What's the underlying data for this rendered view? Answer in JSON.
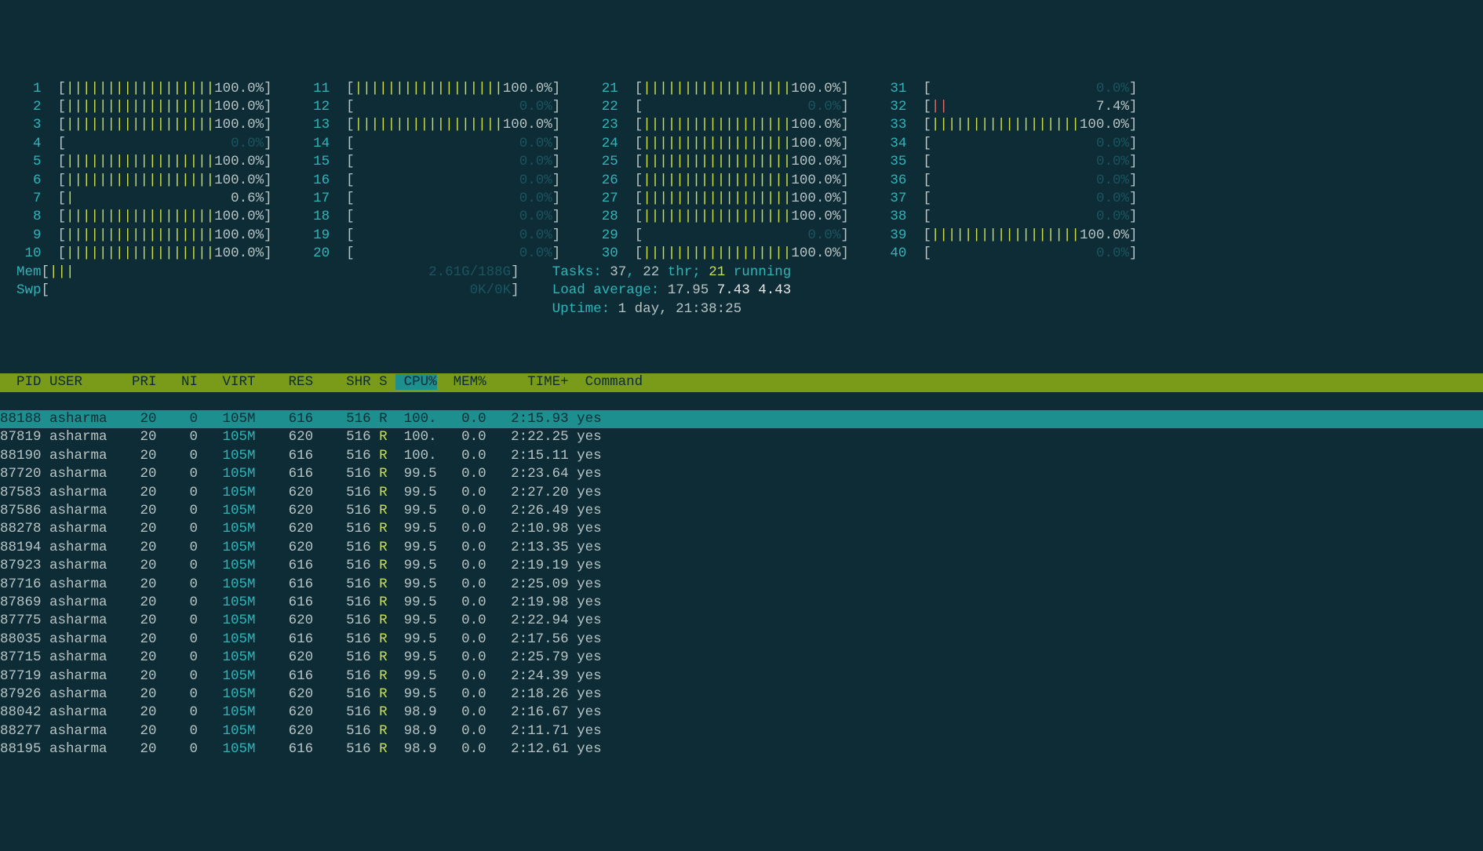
{
  "meters": {
    "layout_columns": 4,
    "cpus": [
      {
        "n": 1,
        "pct": 100.0,
        "bars": "||||||||||||||||||",
        "bar_color": "green"
      },
      {
        "n": 2,
        "pct": 100.0,
        "bars": "||||||||||||||||||",
        "bar_color": "green"
      },
      {
        "n": 3,
        "pct": 100.0,
        "bars": "||||||||||||||||||",
        "bar_color": "green"
      },
      {
        "n": 4,
        "pct": 0.0,
        "bars": "",
        "bar_color": "green"
      },
      {
        "n": 5,
        "pct": 100.0,
        "bars": "||||||||||||||||||",
        "bar_color": "green"
      },
      {
        "n": 6,
        "pct": 100.0,
        "bars": "||||||||||||||||||",
        "bar_color": "green"
      },
      {
        "n": 7,
        "pct": 0.6,
        "bars": "|",
        "bar_color": "green"
      },
      {
        "n": 8,
        "pct": 100.0,
        "bars": "||||||||||||||||||",
        "bar_color": "green"
      },
      {
        "n": 9,
        "pct": 100.0,
        "bars": "||||||||||||||||||",
        "bar_color": "green"
      },
      {
        "n": 10,
        "pct": 100.0,
        "bars": "||||||||||||||||||",
        "bar_color": "green"
      },
      {
        "n": 11,
        "pct": 100.0,
        "bars": "||||||||||||||||||",
        "bar_color": "green"
      },
      {
        "n": 12,
        "pct": 0.0,
        "bars": "",
        "bar_color": "green"
      },
      {
        "n": 13,
        "pct": 100.0,
        "bars": "||||||||||||||||||",
        "bar_color": "green"
      },
      {
        "n": 14,
        "pct": 0.0,
        "bars": "",
        "bar_color": "green"
      },
      {
        "n": 15,
        "pct": 0.0,
        "bars": "",
        "bar_color": "green"
      },
      {
        "n": 16,
        "pct": 0.0,
        "bars": "",
        "bar_color": "green"
      },
      {
        "n": 17,
        "pct": 0.0,
        "bars": "",
        "bar_color": "green"
      },
      {
        "n": 18,
        "pct": 0.0,
        "bars": "",
        "bar_color": "green"
      },
      {
        "n": 19,
        "pct": 0.0,
        "bars": "",
        "bar_color": "green"
      },
      {
        "n": 20,
        "pct": 0.0,
        "bars": "",
        "bar_color": "green"
      },
      {
        "n": 21,
        "pct": 100.0,
        "bars": "||||||||||||||||||",
        "bar_color": "green"
      },
      {
        "n": 22,
        "pct": 0.0,
        "bars": "",
        "bar_color": "green"
      },
      {
        "n": 23,
        "pct": 100.0,
        "bars": "||||||||||||||||||",
        "bar_color": "green"
      },
      {
        "n": 24,
        "pct": 100.0,
        "bars": "||||||||||||||||||",
        "bar_color": "green"
      },
      {
        "n": 25,
        "pct": 100.0,
        "bars": "||||||||||||||||||",
        "bar_color": "green"
      },
      {
        "n": 26,
        "pct": 100.0,
        "bars": "||||||||||||||||||",
        "bar_color": "green"
      },
      {
        "n": 27,
        "pct": 100.0,
        "bars": "||||||||||||||||||",
        "bar_color": "green"
      },
      {
        "n": 28,
        "pct": 100.0,
        "bars": "||||||||||||||||||",
        "bar_color": "green"
      },
      {
        "n": 29,
        "pct": 0.0,
        "bars": "",
        "bar_color": "green"
      },
      {
        "n": 30,
        "pct": 100.0,
        "bars": "||||||||||||||||||",
        "bar_color": "green"
      },
      {
        "n": 31,
        "pct": 0.0,
        "bars": "",
        "bar_color": "green"
      },
      {
        "n": 32,
        "pct": 7.4,
        "bars": "||",
        "bar_color": "red"
      },
      {
        "n": 33,
        "pct": 100.0,
        "bars": "||||||||||||||||||",
        "bar_color": "green"
      },
      {
        "n": 34,
        "pct": 0.0,
        "bars": "",
        "bar_color": "green"
      },
      {
        "n": 35,
        "pct": 0.0,
        "bars": "",
        "bar_color": "green"
      },
      {
        "n": 36,
        "pct": 0.0,
        "bars": "",
        "bar_color": "green"
      },
      {
        "n": 37,
        "pct": 0.0,
        "bars": "",
        "bar_color": "green"
      },
      {
        "n": 38,
        "pct": 0.0,
        "bars": "",
        "bar_color": "green"
      },
      {
        "n": 39,
        "pct": 100.0,
        "bars": "||||||||||||||||||",
        "bar_color": "green"
      },
      {
        "n": 40,
        "pct": 0.0,
        "bars": "",
        "bar_color": "green"
      }
    ],
    "mem": {
      "label": "Mem",
      "bars": "|||",
      "used": "2.61G",
      "total": "188G"
    },
    "swp": {
      "label": "Swp",
      "bars": "",
      "used": "0K",
      "total": "0K"
    }
  },
  "summary": {
    "tasks_label": "Tasks:",
    "tasks_total": "37",
    "tasks_sep": ", ",
    "thr_count": "22",
    "thr_label": " thr; ",
    "running_count": "21",
    "running_label": " running",
    "load_label": "Load average:",
    "load1": "17.95",
    "load5": "7.43",
    "load15": "4.43",
    "uptime_label": "Uptime:",
    "uptime_value": "1 day, 21:38:25"
  },
  "table": {
    "columns": [
      "PID",
      "USER",
      "PRI",
      "NI",
      "VIRT",
      "RES",
      "SHR",
      "S",
      "CPU%",
      "MEM%",
      "TIME+",
      "Command"
    ],
    "sort_column": "CPU%",
    "selected_index": 0,
    "rows": [
      {
        "pid": "88188",
        "user": "asharma",
        "pri": "20",
        "ni": "0",
        "virt": "105M",
        "res": "616",
        "shr": "516",
        "s": "R",
        "cpu": "100.",
        "mem": "0.0",
        "time": "2:15.93",
        "cmd": "yes"
      },
      {
        "pid": "87819",
        "user": "asharma",
        "pri": "20",
        "ni": "0",
        "virt": "105M",
        "res": "620",
        "shr": "516",
        "s": "R",
        "cpu": "100.",
        "mem": "0.0",
        "time": "2:22.25",
        "cmd": "yes"
      },
      {
        "pid": "88190",
        "user": "asharma",
        "pri": "20",
        "ni": "0",
        "virt": "105M",
        "res": "616",
        "shr": "516",
        "s": "R",
        "cpu": "100.",
        "mem": "0.0",
        "time": "2:15.11",
        "cmd": "yes"
      },
      {
        "pid": "87720",
        "user": "asharma",
        "pri": "20",
        "ni": "0",
        "virt": "105M",
        "res": "616",
        "shr": "516",
        "s": "R",
        "cpu": "99.5",
        "mem": "0.0",
        "time": "2:23.64",
        "cmd": "yes"
      },
      {
        "pid": "87583",
        "user": "asharma",
        "pri": "20",
        "ni": "0",
        "virt": "105M",
        "res": "620",
        "shr": "516",
        "s": "R",
        "cpu": "99.5",
        "mem": "0.0",
        "time": "2:27.20",
        "cmd": "yes"
      },
      {
        "pid": "87586",
        "user": "asharma",
        "pri": "20",
        "ni": "0",
        "virt": "105M",
        "res": "620",
        "shr": "516",
        "s": "R",
        "cpu": "99.5",
        "mem": "0.0",
        "time": "2:26.49",
        "cmd": "yes"
      },
      {
        "pid": "88278",
        "user": "asharma",
        "pri": "20",
        "ni": "0",
        "virt": "105M",
        "res": "620",
        "shr": "516",
        "s": "R",
        "cpu": "99.5",
        "mem": "0.0",
        "time": "2:10.98",
        "cmd": "yes"
      },
      {
        "pid": "88194",
        "user": "asharma",
        "pri": "20",
        "ni": "0",
        "virt": "105M",
        "res": "620",
        "shr": "516",
        "s": "R",
        "cpu": "99.5",
        "mem": "0.0",
        "time": "2:13.35",
        "cmd": "yes"
      },
      {
        "pid": "87923",
        "user": "asharma",
        "pri": "20",
        "ni": "0",
        "virt": "105M",
        "res": "616",
        "shr": "516",
        "s": "R",
        "cpu": "99.5",
        "mem": "0.0",
        "time": "2:19.19",
        "cmd": "yes"
      },
      {
        "pid": "87716",
        "user": "asharma",
        "pri": "20",
        "ni": "0",
        "virt": "105M",
        "res": "616",
        "shr": "516",
        "s": "R",
        "cpu": "99.5",
        "mem": "0.0",
        "time": "2:25.09",
        "cmd": "yes"
      },
      {
        "pid": "87869",
        "user": "asharma",
        "pri": "20",
        "ni": "0",
        "virt": "105M",
        "res": "616",
        "shr": "516",
        "s": "R",
        "cpu": "99.5",
        "mem": "0.0",
        "time": "2:19.98",
        "cmd": "yes"
      },
      {
        "pid": "87775",
        "user": "asharma",
        "pri": "20",
        "ni": "0",
        "virt": "105M",
        "res": "620",
        "shr": "516",
        "s": "R",
        "cpu": "99.5",
        "mem": "0.0",
        "time": "2:22.94",
        "cmd": "yes"
      },
      {
        "pid": "88035",
        "user": "asharma",
        "pri": "20",
        "ni": "0",
        "virt": "105M",
        "res": "616",
        "shr": "516",
        "s": "R",
        "cpu": "99.5",
        "mem": "0.0",
        "time": "2:17.56",
        "cmd": "yes"
      },
      {
        "pid": "87715",
        "user": "asharma",
        "pri": "20",
        "ni": "0",
        "virt": "105M",
        "res": "620",
        "shr": "516",
        "s": "R",
        "cpu": "99.5",
        "mem": "0.0",
        "time": "2:25.79",
        "cmd": "yes"
      },
      {
        "pid": "87719",
        "user": "asharma",
        "pri": "20",
        "ni": "0",
        "virt": "105M",
        "res": "616",
        "shr": "516",
        "s": "R",
        "cpu": "99.5",
        "mem": "0.0",
        "time": "2:24.39",
        "cmd": "yes"
      },
      {
        "pid": "87926",
        "user": "asharma",
        "pri": "20",
        "ni": "0",
        "virt": "105M",
        "res": "620",
        "shr": "516",
        "s": "R",
        "cpu": "99.5",
        "mem": "0.0",
        "time": "2:18.26",
        "cmd": "yes"
      },
      {
        "pid": "88042",
        "user": "asharma",
        "pri": "20",
        "ni": "0",
        "virt": "105M",
        "res": "620",
        "shr": "516",
        "s": "R",
        "cpu": "98.9",
        "mem": "0.0",
        "time": "2:16.67",
        "cmd": "yes"
      },
      {
        "pid": "88277",
        "user": "asharma",
        "pri": "20",
        "ni": "0",
        "virt": "105M",
        "res": "620",
        "shr": "516",
        "s": "R",
        "cpu": "98.9",
        "mem": "0.0",
        "time": "2:11.71",
        "cmd": "yes"
      },
      {
        "pid": "88195",
        "user": "asharma",
        "pri": "20",
        "ni": "0",
        "virt": "105M",
        "res": "616",
        "shr": "516",
        "s": "R",
        "cpu": "98.9",
        "mem": "0.0",
        "time": "2:12.61",
        "cmd": "yes"
      }
    ]
  }
}
